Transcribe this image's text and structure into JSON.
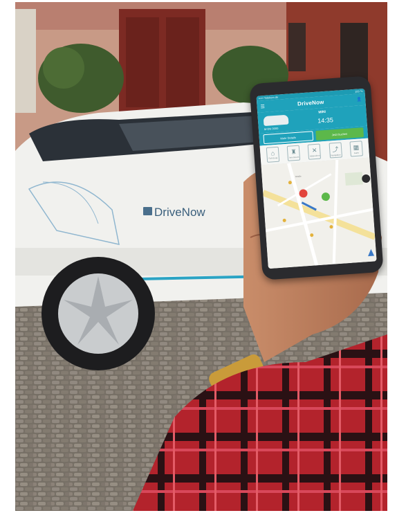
{
  "photo": {
    "car_door_logo": "DriveNow"
  },
  "phone_app": {
    "status_bar": {
      "carrier": "••••• Telekom.de",
      "battery": "100 %"
    },
    "brand": "DriveNow",
    "vehicle": {
      "model": "MINI",
      "plate": "M-DN 0000",
      "time": "14:35"
    },
    "buttons": {
      "left": "Mehr Details",
      "right": "Jetzt buchen"
    },
    "icons": [
      "car-icon",
      "seat-icon",
      "cancel-icon",
      "route-icon",
      "map-icon"
    ],
    "icon_labels": [
      "Fahrzeug",
      "Innenraum",
      "Abbrechen",
      "Navigation",
      "Karte"
    ],
    "map": {
      "street_label": "Straße"
    },
    "colors": {
      "brand_teal": "#1fa2bb",
      "action_green": "#5cb84a",
      "marker_red": "#e2453c"
    }
  },
  "colors": {
    "shirt_red": "#b3232c",
    "car_white": "#f1f1ee",
    "door_red": "#7c2a23",
    "cobblestone": "#8a8379"
  }
}
